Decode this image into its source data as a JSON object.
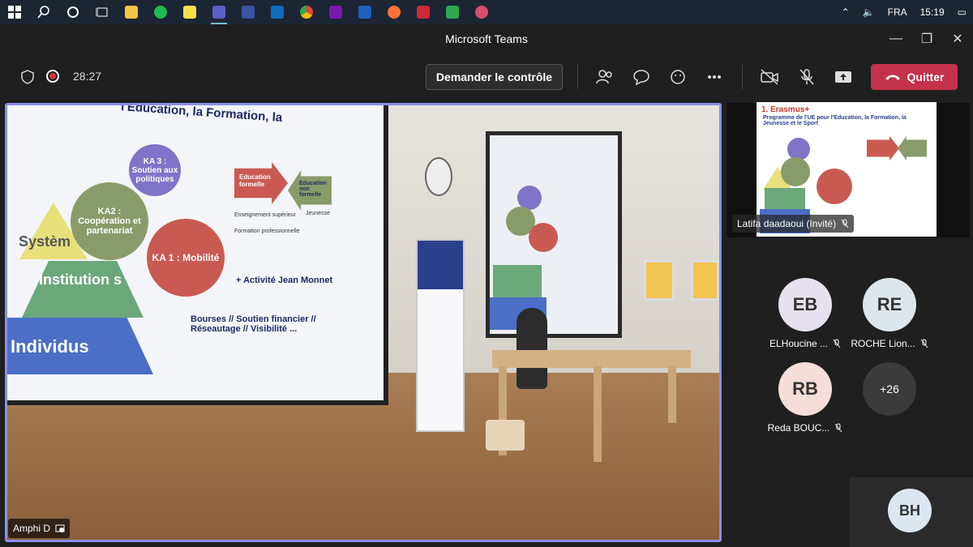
{
  "taskbar": {
    "icons": [
      "windows-start-icon",
      "search-icon",
      "cortana-icon",
      "task-view-icon",
      "file-explorer-icon",
      "spotify-icon",
      "sticky-notes-icon",
      "teams-icon",
      "visio-icon",
      "outlook-icon",
      "chrome-icon",
      "onenote-icon",
      "vscode-icon",
      "firefox-icon",
      "zotero-icon",
      "app-icon",
      "app2-icon"
    ],
    "language": "FRA",
    "time": "15:19"
  },
  "window": {
    "title": "Microsoft Teams"
  },
  "meeting": {
    "timer": "28:27",
    "request_control_label": "Demander le contrôle",
    "leave_label": "Quitter",
    "accent_leave": "#c4314b"
  },
  "stage": {
    "label": "Amphi D",
    "slide": {
      "header_line": "l'Education, la Formation, la",
      "ka3": "KA 3 : Soutien aux politiques",
      "ka2": "KA2 : Coopération et partenariat",
      "ka1": "KA 1 : Mobilité",
      "system": "Systèm",
      "institutions": "Institution s",
      "individus": "Individus",
      "edu_formelle": "Education formelle",
      "edu_non_formelle": "Education non formelle",
      "bullets": [
        "Enseignement supérieur",
        "Formation professionnelle"
      ],
      "jeunesse": "Jeunesse",
      "jean_monnet": "+ Activité Jean Monnet",
      "bourses": "Bourses // Soutien financier // Réseautage // Visibilité ..."
    }
  },
  "share": {
    "name": "Latifa daadaoui (Invité)",
    "slide_title": "1. Erasmus+",
    "slide_subtitle": "Programme de l'UE pour l'Education, la Formation, la Jeunesse et le Sport"
  },
  "participants": [
    {
      "initials": "EB",
      "name": "ELHoucine ...",
      "color": "#e5e1ee"
    },
    {
      "initials": "RE",
      "name": "ROCHE Lion...",
      "color": "#dde6ea"
    },
    {
      "initials": "RB",
      "name": "Reda BOUC...",
      "color": "#f5ddd8"
    }
  ],
  "more_count": "+26",
  "self_initials": "BH"
}
